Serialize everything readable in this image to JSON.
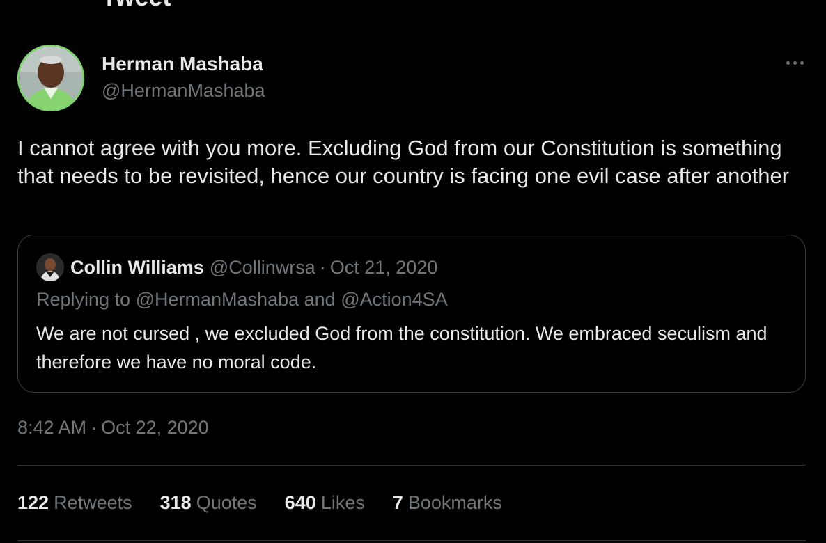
{
  "header": {
    "title": "Tweet"
  },
  "author": {
    "name": "Herman Mashaba",
    "handle": "@HermanMashaba"
  },
  "tweet": {
    "text": "I cannot agree with you more. Excluding God from our Constitution is something that needs to be revisited, hence our country is facing one evil case after another",
    "timestamp_time": "8:42 AM",
    "timestamp_sep": "·",
    "timestamp_date": "Oct 22, 2020"
  },
  "quote": {
    "name": "Collin Williams",
    "handle": "@Collinwrsa",
    "sep": "·",
    "date": "Oct 21, 2020",
    "replying_prefix": "Replying to",
    "replying_mention_1": "@HermanMashaba",
    "replying_and": "and",
    "replying_mention_2": "@Action4SA",
    "text": "We are not cursed , we excluded God from the constitution. We embraced seculism and therefore we have no moral code."
  },
  "stats": {
    "retweets": {
      "count": "122",
      "label": "Retweets"
    },
    "quotes": {
      "count": "318",
      "label": "Quotes"
    },
    "likes": {
      "count": "640",
      "label": "Likes"
    },
    "bookmarks": {
      "count": "7",
      "label": "Bookmarks"
    }
  },
  "icons": {
    "more": "more-horizontal-icon"
  },
  "colors": {
    "background": "#000000",
    "primary_text": "#e7e9ea",
    "secondary_text": "#71767b",
    "border": "#2f3336",
    "avatar_ring": "#7bd36b"
  }
}
